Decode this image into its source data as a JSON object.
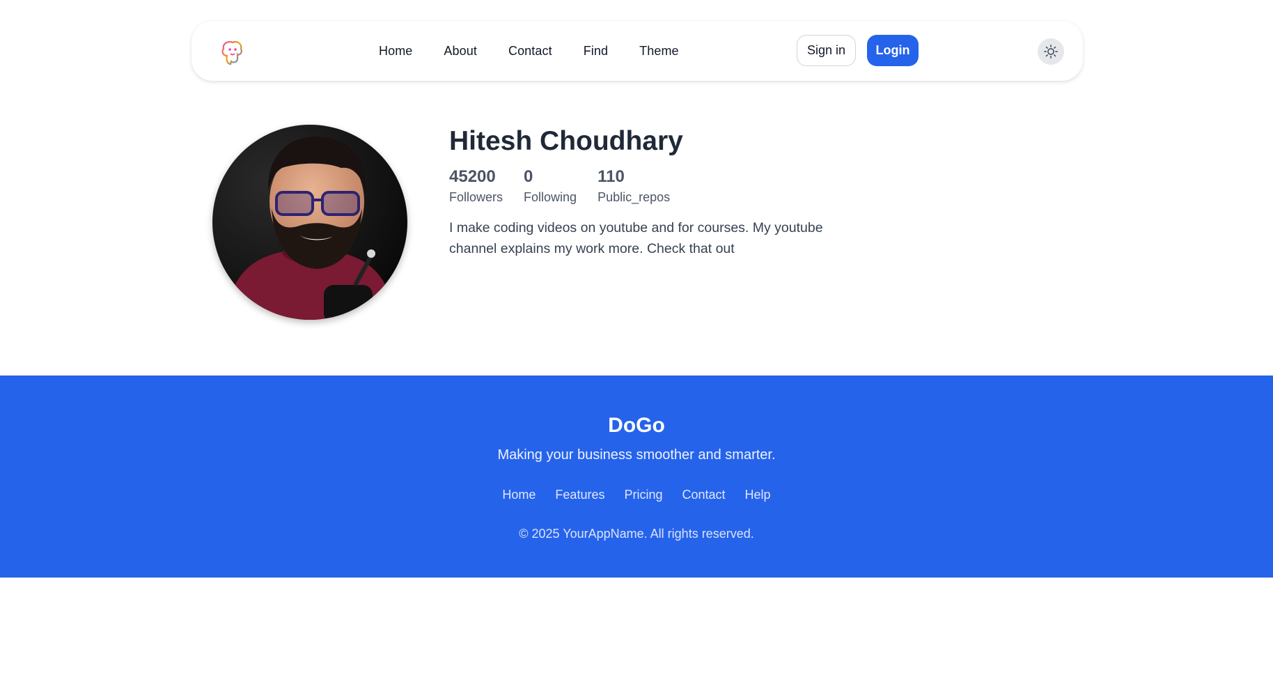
{
  "nav": {
    "links": [
      "Home",
      "About",
      "Contact",
      "Find",
      "Theme"
    ],
    "signin_label": "Sign in",
    "login_label": "Login",
    "logo_icon": "dog-logo-icon",
    "theme_icon": "sun-icon"
  },
  "profile": {
    "name": "Hitesh Choudhary",
    "stats": [
      {
        "value": "45200",
        "label": "Followers"
      },
      {
        "value": "0",
        "label": "Following"
      },
      {
        "value": "110",
        "label": "Public_repos"
      }
    ],
    "bio": "I make coding videos on youtube and for courses. My youtube channel explains my work more. Check that out"
  },
  "footer": {
    "brand": "DoGo",
    "tagline": "Making your business smoother and smarter.",
    "links": [
      "Home",
      "Features",
      "Pricing",
      "Contact",
      "Help"
    ],
    "copyright": "© 2025 YourAppName. All rights reserved."
  },
  "colors": {
    "primary": "#2563eb",
    "text": "#1f2937",
    "muted": "#4b5563"
  }
}
